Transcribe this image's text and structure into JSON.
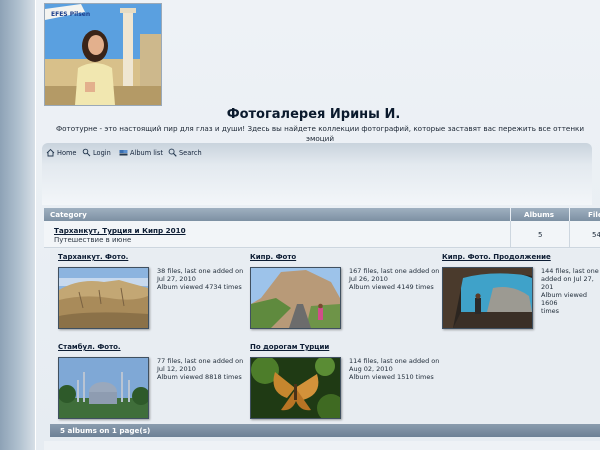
{
  "site": {
    "title": "Фотогалерея Ирины И.",
    "description": "Фототурне - это настоящий пир для глаз и души! Здесь вы найдете коллекции фотографий, которые заставят вас пережить все оттенки эмоций",
    "logo_sign_text": "EFES Pilsen"
  },
  "nav": {
    "home": "Home",
    "login": "Login",
    "album_list": "Album list",
    "search": "Search"
  },
  "table": {
    "col_category": "Category",
    "col_albums": "Albums",
    "col_files": "File"
  },
  "category": {
    "name": "Тарханкут, Турция и Кипр 2010",
    "description": "Путешествие в июне",
    "albums": "5",
    "files": "54"
  },
  "albums": [
    {
      "title": "Тарханкут. Фото.",
      "line1": "38 files, last one added on",
      "line2": "Jul 27, 2010",
      "line3": "Album viewed 4734 times"
    },
    {
      "title": "Кипр. Фото",
      "line1": "167 files, last one added on",
      "line2": "Jul 26, 2010",
      "line3": "Album viewed 4149 times"
    },
    {
      "title": "Кипр. Фото. Продолжение",
      "line1": "144 files, last one",
      "line2": "added on Jul 27, 201",
      "line3": "Album viewed 1606",
      "line4": "times"
    },
    {
      "title": "Стамбул. Фото.",
      "line1": "77 files, last one added on",
      "line2": "Jul 12, 2010",
      "line3": "Album viewed 8818 times"
    },
    {
      "title": "По дорогам Турции",
      "line1": "114 files, last one added on",
      "line2": "Aug 02, 2010",
      "line3": "Album viewed 1510 times"
    }
  ],
  "footer": {
    "albums_count": "5 albums on 1 page(s)"
  },
  "icons": [
    "home-icon",
    "login-icon",
    "album-list-icon",
    "search-icon"
  ],
  "colors": {
    "header_bar": "#8a9cae",
    "page_bg": "#e6ecf2",
    "link": "#0c1c33"
  }
}
